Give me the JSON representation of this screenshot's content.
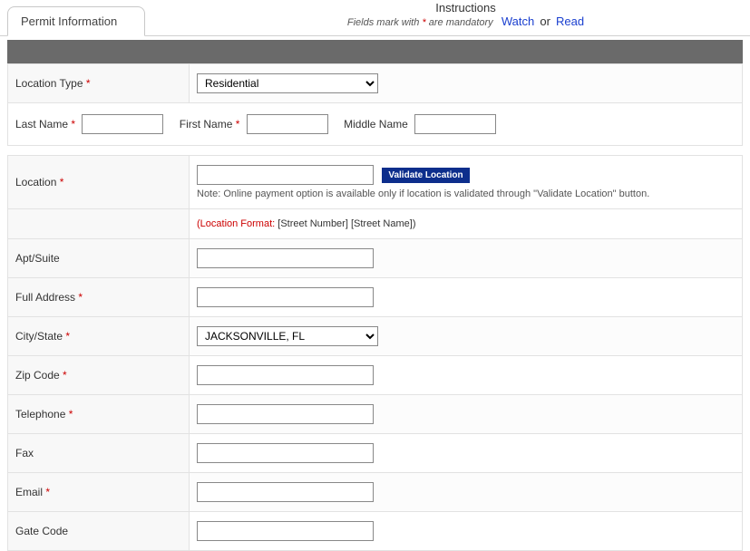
{
  "tab": {
    "label": "Permit Information"
  },
  "instructions": {
    "title": "Instructions",
    "mandatory_prefix": "Fields mark with ",
    "mandatory_symbol": "*",
    "mandatory_suffix": " are mandatory",
    "watch": "Watch",
    "or": "or",
    "read": "Read"
  },
  "fields": {
    "location_type": {
      "label": "Location Type",
      "required": true,
      "value": "Residential"
    },
    "last_name": {
      "label": "Last Name",
      "required": true,
      "value": ""
    },
    "first_name": {
      "label": "First Name",
      "required": true,
      "value": ""
    },
    "middle_name": {
      "label": "Middle Name",
      "required": false,
      "value": ""
    },
    "location": {
      "label": "Location",
      "required": true,
      "value": "",
      "validate_button": "Validate Location",
      "note": "Note: Online payment option is available only if location is validated through \"Validate Location\" button.",
      "format_label": "(Location Format:",
      "format_hint": "  [Street Number] [Street Name])"
    },
    "apt_suite": {
      "label": "Apt/Suite",
      "required": false,
      "value": ""
    },
    "full_address": {
      "label": "Full Address",
      "required": true,
      "value": ""
    },
    "city_state": {
      "label": "City/State",
      "required": true,
      "value": "JACKSONVILLE, FL"
    },
    "zip_code": {
      "label": "Zip Code",
      "required": true,
      "value": ""
    },
    "telephone": {
      "label": "Telephone",
      "required": true,
      "value": ""
    },
    "fax": {
      "label": "Fax",
      "required": false,
      "value": ""
    },
    "email": {
      "label": "Email",
      "required": true,
      "value": ""
    },
    "gate_code": {
      "label": "Gate Code",
      "required": false,
      "value": ""
    }
  }
}
